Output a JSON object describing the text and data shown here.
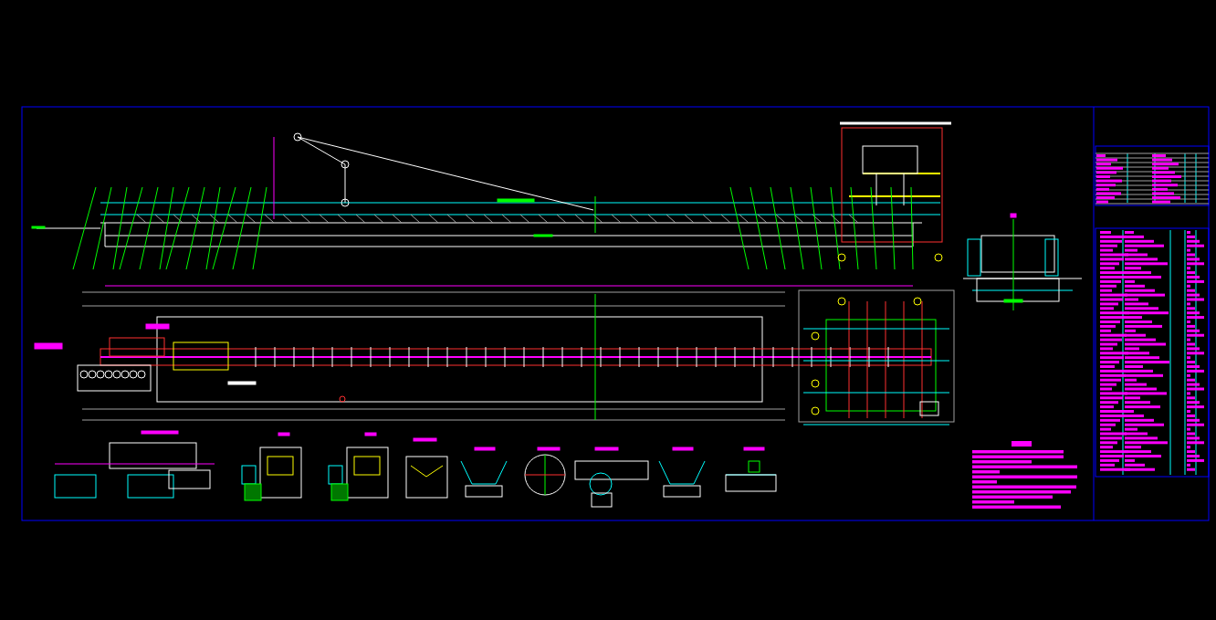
{
  "drawing_sheet": {
    "views": [
      {
        "kind": "frame"
      },
      {
        "kind": "elevation"
      },
      {
        "kind": "plan"
      },
      {
        "kind": "section"
      },
      {
        "kind": "drive-unit"
      },
      {
        "kind": "pulley"
      },
      {
        "kind": "pulley"
      },
      {
        "kind": "idler"
      },
      {
        "kind": "trough-idler"
      },
      {
        "kind": "wheel"
      },
      {
        "kind": "carriage"
      },
      {
        "kind": "trough-idler"
      },
      {
        "kind": "return-idler"
      },
      {
        "kind": "notes"
      },
      {
        "kind": "parts-table"
      }
    ]
  }
}
